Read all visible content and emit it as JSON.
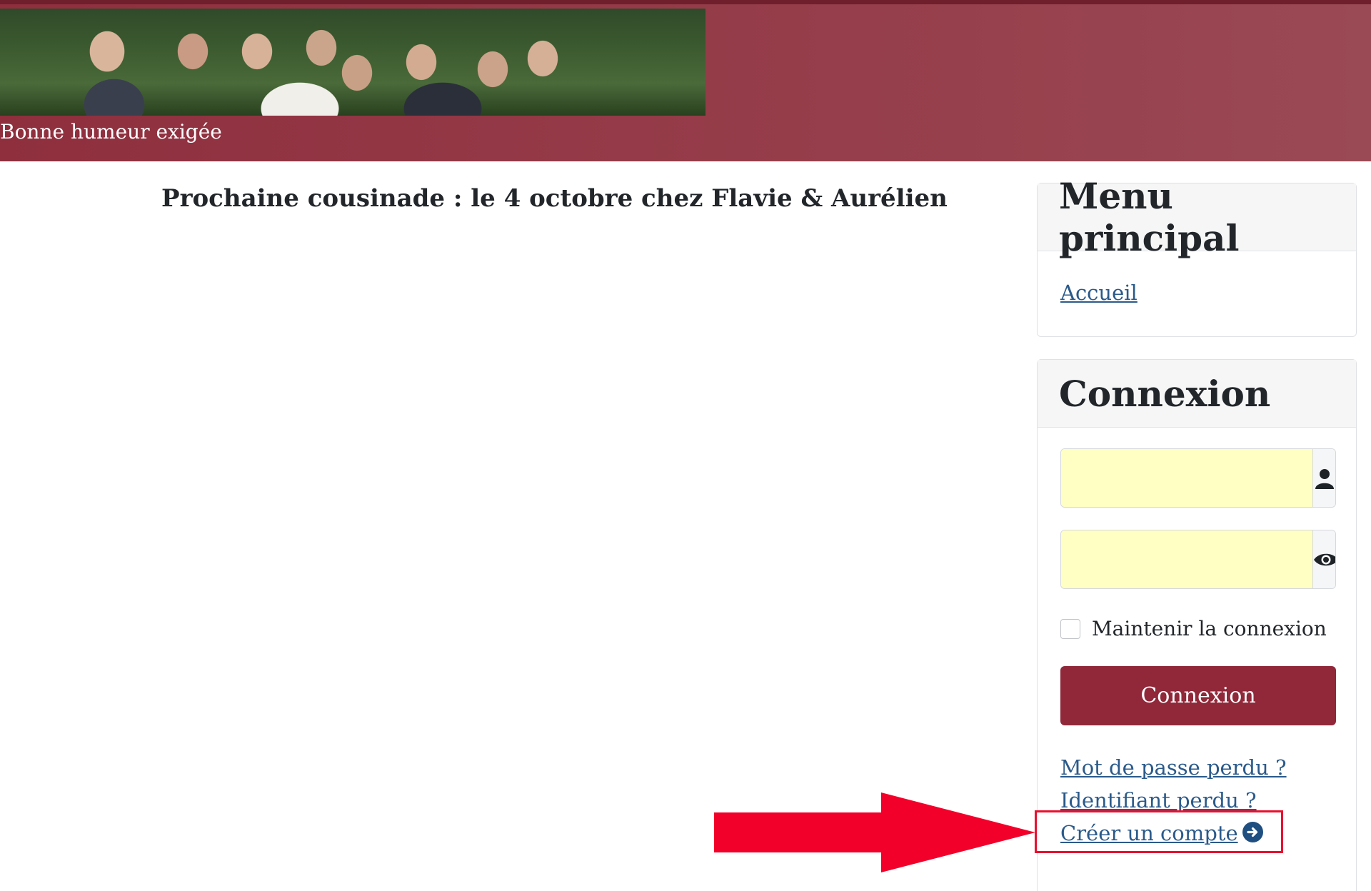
{
  "header": {
    "tagline": "Bonne humeur exigée"
  },
  "main": {
    "title": "Prochaine cousinade : le 4 octobre chez Flavie & Aurélien"
  },
  "menu": {
    "title": "Menu principal",
    "items": [
      {
        "label": "Accueil"
      }
    ]
  },
  "login": {
    "title": "Connexion",
    "username_value": "",
    "password_value": "",
    "remember_label": "Maintenir la connexion",
    "submit_label": "Connexion",
    "links": {
      "lost_password": "Mot de passe perdu ?",
      "lost_username": "Identifiant perdu ?",
      "create_account": "Créer un compte"
    }
  },
  "icons": {
    "user": "user-icon",
    "eye": "eye-icon",
    "arrow": "arrow-circle-right-icon"
  },
  "colors": {
    "header_bg": "#93343f",
    "button_bg": "#90283a",
    "link": "#2b5a8a",
    "input_bg": "#ffffc4",
    "annotation": "#e8102f"
  }
}
